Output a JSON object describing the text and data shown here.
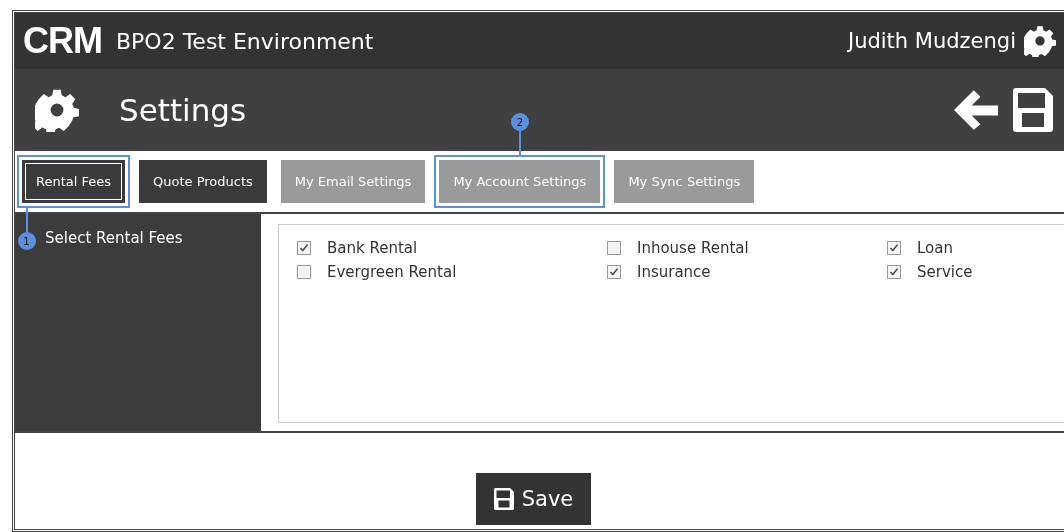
{
  "header": {
    "logo": "CRM",
    "environment": "BPO2 Test Environment",
    "user": "Judith Mudzengi"
  },
  "page_title": "Settings",
  "tabs": [
    {
      "label": "Rental Fees",
      "kind": "dark",
      "selected": true,
      "highlighted": true,
      "callout": {
        "label": "1",
        "kind": "below"
      }
    },
    {
      "label": "Quote Products",
      "kind": "dark",
      "selected": false,
      "highlighted": false
    },
    {
      "label": "My Email Settings",
      "kind": "light",
      "selected": false,
      "highlighted": false
    },
    {
      "label": "My Account Settings",
      "kind": "light",
      "selected": false,
      "highlighted": true,
      "callout": {
        "label": "2",
        "kind": "above"
      }
    },
    {
      "label": "My Sync Settings",
      "kind": "light",
      "selected": false,
      "highlighted": false
    }
  ],
  "sidebar": {
    "title": "Select Rental Fees"
  },
  "fees": [
    {
      "label": "Bank Rental",
      "checked": true
    },
    {
      "label": "Evergreen Rental",
      "checked": false
    },
    {
      "label": "Inhouse Rental",
      "checked": false
    },
    {
      "label": "Insurance",
      "checked": true
    },
    {
      "label": "Loan",
      "checked": true
    },
    {
      "label": "Service",
      "checked": true
    }
  ],
  "save_button": "Save"
}
